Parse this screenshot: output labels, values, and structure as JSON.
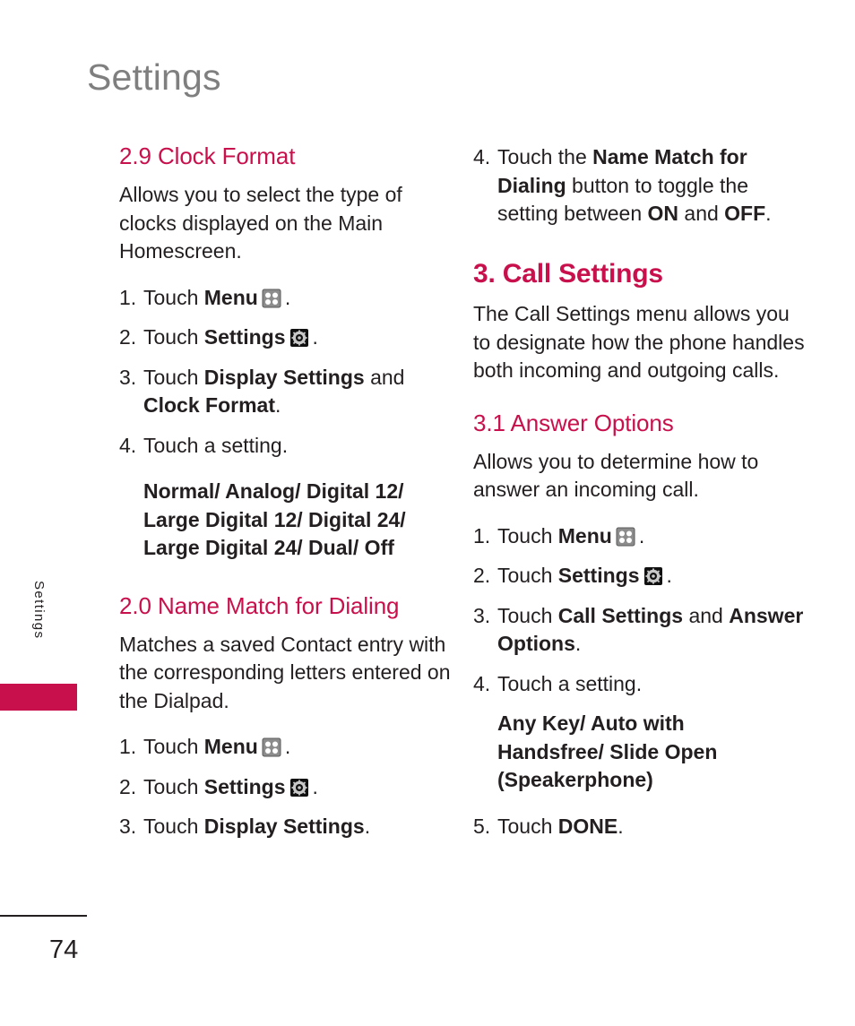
{
  "page": {
    "title": "Settings",
    "side_tab_label": "Settings",
    "page_number": "74",
    "accent_color": "#c8104c",
    "title_color": "#7f7f7f",
    "text_color": "#231f20"
  },
  "icons": {
    "menu": "menu-grid-icon",
    "settings": "settings-gear-icon"
  },
  "left_column": {
    "heading_clock_format": "2.9 Clock Format",
    "intro_clock_format": "Allows you to select the type of clocks displayed on the Main Homescreen.",
    "steps_clock_format": [
      {
        "num": "1.",
        "pre": "Touch ",
        "bold": "Menu",
        "icon": "menu",
        "post": "."
      },
      {
        "num": "2.",
        "pre": "Touch ",
        "bold": "Settings",
        "icon": "settings",
        "post": "."
      },
      {
        "num": "3.",
        "pre": "Touch ",
        "bold": "Display Settings",
        "mid": " and ",
        "bold2": "Clock Format",
        "post": "."
      },
      {
        "num": "4.",
        "pre": "Touch a setting.",
        "post": ""
      }
    ],
    "options_clock_format": [
      "Normal/ Analog/ Digital 12/",
      "Large Digital 12/ Digital 24/",
      "Large Digital 24/ Dual/ Off"
    ],
    "heading_name_match": "2.0 Name Match for Dialing",
    "intro_name_match": "Matches a saved Contact entry with the corresponding letters entered on the Dialpad.",
    "steps_name_match": [
      {
        "num": "1.",
        "pre": "Touch ",
        "bold": "Menu",
        "icon": "menu",
        "post": "."
      },
      {
        "num": "2.",
        "pre": "Touch ",
        "bold": "Settings",
        "icon": "settings",
        "post": "."
      },
      {
        "num": "3.",
        "pre": "Touch ",
        "bold": "Display Settings",
        "post": "."
      }
    ]
  },
  "right_column": {
    "step_four_name_match": {
      "num": "4.",
      "seg1": "Touch the ",
      "bold1": "Name Match for Dialing",
      "seg2": " button to toggle the setting between ",
      "bold2": "ON",
      "seg3": " and ",
      "bold3": "OFF",
      "seg4": "."
    },
    "heading_call_settings": "3. Call Settings",
    "intro_call_settings": "The Call Settings menu allows you to designate how the phone handles both incoming and outgoing calls.",
    "heading_answer_options": "3.1 Answer Options",
    "intro_answer_options": "Allows you to determine how to answer an incoming call.",
    "steps_answer_options": [
      {
        "num": "1.",
        "pre": "Touch ",
        "bold": "Menu",
        "icon": "menu",
        "post": "."
      },
      {
        "num": "2.",
        "pre": "Touch ",
        "bold": "Settings",
        "icon": "settings",
        "post": "."
      },
      {
        "num": "3.",
        "pre": "Touch ",
        "bold": "Call Settings",
        "mid": " and ",
        "bold2": "Answer Options",
        "post": "."
      },
      {
        "num": "4.",
        "pre": "Touch a setting.",
        "post": ""
      },
      {
        "num": "5.",
        "pre": "Touch ",
        "bold": "DONE",
        "post": "."
      }
    ],
    "options_answer_options": [
      "Any Key/ Auto with",
      "Handsfree/ Slide Open",
      "(Speakerphone)"
    ]
  }
}
